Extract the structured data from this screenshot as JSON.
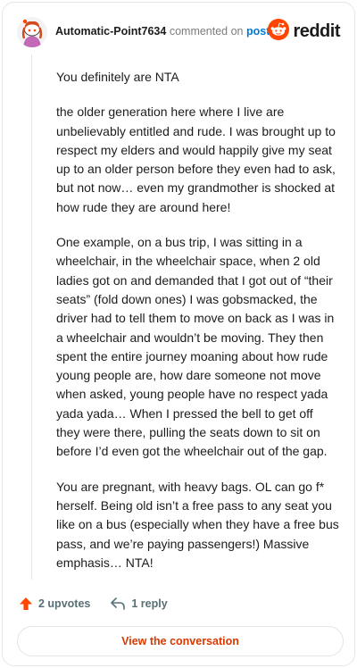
{
  "header": {
    "username": "Automatic-Point7634",
    "commented_on": "commented on",
    "post_link": "post",
    "brand": "reddit"
  },
  "comment": {
    "paragraphs": [
      "You definitely are NTA",
      "the older generation here where I live are unbelievably entitled and rude. I was brought up to respect my elders and would happily give my seat up to an older person before they even had to ask, but not now… even my grandmother is shocked at how rude they are around here!",
      "One example, on a bus trip, I was sitting in a wheelchair, in the wheelchair space, when 2 old ladies got on and demanded that I got out of “their seats” (fold down ones) I was gobsmacked, the driver had to tell them to move on back as I was in a wheelchair and wouldn’t be moving. They then spent the entire journey moaning about how rude young people are, how dare someone not move when asked, young people have no respect yada yada yada… When I pressed the bell to get off they were there, pulling the seats down to sit on before I’d even got the wheelchair out of the gap.",
      "You are pregnant, with heavy bags. OL can go f* herself. Being old isn’t a free pass to any seat you like on a bus (especially when they have a free bus pass, and we’re paying passengers!) Massive emphasis… NTA!"
    ]
  },
  "actions": {
    "upvotes": "2 upvotes",
    "replies": "1 reply"
  },
  "footer": {
    "view_label": "View the conversation"
  },
  "colors": {
    "brand_orange": "#ff4500",
    "link_blue": "#0079d3",
    "cta_red": "#d93900"
  },
  "icons": {
    "avatar": "snoo-avatar",
    "logo": "reddit-snoo-icon",
    "upvote": "upvote-arrow-icon",
    "reply": "reply-arrow-icon"
  }
}
